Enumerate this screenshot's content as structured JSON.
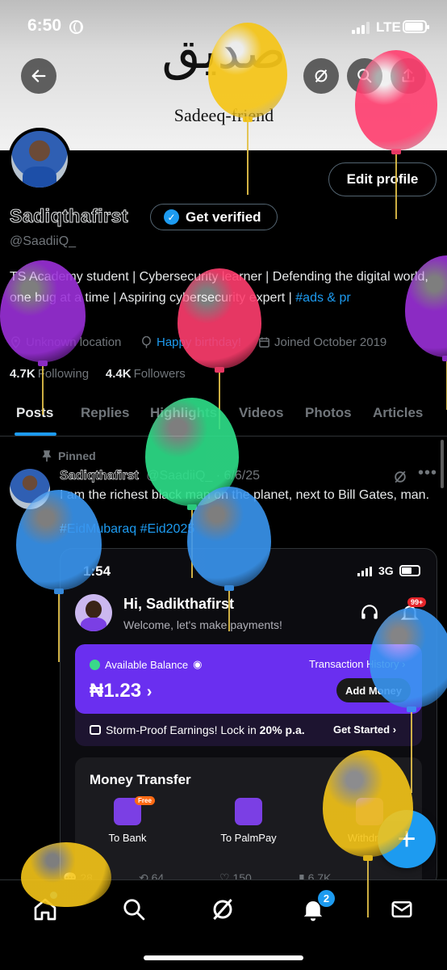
{
  "status_bar": {
    "time": "6:50",
    "network": "LTE"
  },
  "banner": {
    "arabic_text": "صديق",
    "caption": "Sadeeq-friend"
  },
  "header": {
    "back_icon": "arrow-left-icon",
    "grok_icon": "grok-icon",
    "search_icon": "search-icon",
    "share_icon": "share-icon"
  },
  "profile": {
    "display_name": "Sadiqthafirst",
    "handle": "@SaadiiQ_",
    "edit_label": "Edit profile",
    "verify_label": "Get verified",
    "bio_plain": "TS Academy student | Cybersecurity learner | Defending the digital world, one bug at a time | Aspiring cybersecurity expert | ",
    "bio_link": "#ads & pr",
    "location": "Unknown location",
    "birthday": "Happy birthday!",
    "joined": "Joined October 2019",
    "following_count": "4.7K",
    "following_label": "Following",
    "followers_count": "4.4K",
    "followers_label": "Followers"
  },
  "tabs": [
    "Posts",
    "Replies",
    "Highlights",
    "Videos",
    "Photos",
    "Articles"
  ],
  "post": {
    "pinned_label": "Pinned",
    "author": "Sadiqthafirst",
    "handle_date": "@SaadiiQ_ · 6/6/25",
    "text": "I am the richest black man on the planet, next to Bill Gates, man.",
    "hashtags": "#EidMubaraq #Eid2025",
    "engagement": {
      "replies": "28",
      "reposts": "64",
      "likes": "150",
      "views": "6.7K"
    }
  },
  "embed": {
    "time": "1:54",
    "network": "3G",
    "greeting": "Hi, Sadikthafirst",
    "welcome": "Welcome, let's make payments!",
    "notif_badge": "99+",
    "available_balance": "Available Balance",
    "transaction_history": "Transaction History",
    "amount": "₦1.23",
    "add_money": "Add Money",
    "storm_text_a": "Storm-Proof Earnings! Lock in ",
    "storm_text_b": "20% p.a.",
    "get_started": "Get Started",
    "money_transfer": "Money Transfer",
    "to_bank": "To Bank",
    "free_badge": "Free",
    "to_palmpay": "To PalmPay",
    "withdraw": "Withdraw"
  },
  "nav": {
    "notif_count": "2",
    "fab_label": "+"
  },
  "colors": {
    "accent": "#1d9bf0",
    "background": "#000000",
    "muted": "#71767b",
    "purple": "#6a2ff0"
  }
}
